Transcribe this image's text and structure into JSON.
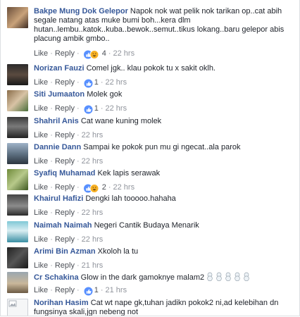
{
  "labels": {
    "like": "Like",
    "reply": "Reply"
  },
  "comments": [
    {
      "name": "Bakpe Mung Dok Gelepor",
      "text": "Napok nok wat pelik nok tarikan op..cat abih segale natang atas muke bumi boh...kera dlm hutan..lembu..katok..kuba..bewok..semut..tikus lokang..baru gelepor abis placung ambik gmbo..",
      "reactions": [
        "like",
        "haha"
      ],
      "count": "4",
      "time": "22 hrs"
    },
    {
      "name": "Norizan Fauzi",
      "text": "Comel jgk.. klau pokok tu x sakit oklh.",
      "reactions": [
        "like"
      ],
      "count": "1",
      "time": "22 hrs"
    },
    {
      "name": "Siti Jumaaton",
      "text": "Molek gok",
      "reactions": [
        "like"
      ],
      "count": "1",
      "time": "22 hrs"
    },
    {
      "name": "Shahril Anis",
      "text": "Cat wane kuning molek",
      "reactions": [],
      "count": "",
      "time": "22 hrs"
    },
    {
      "name": "Dannie Dann",
      "text": "Sampai ke pokok pun mu gi ngecat..ala parok",
      "reactions": [],
      "count": "",
      "time": "22 hrs"
    },
    {
      "name": "Syafiq Muhamad",
      "text": "Kek lapis serawak",
      "reactions": [
        "like",
        "haha"
      ],
      "count": "2",
      "time": "22 hrs"
    },
    {
      "name": "Khairul Hafizi",
      "text": "Dengki lah tooooo.hahaha",
      "reactions": [],
      "count": "",
      "time": "22 hrs"
    },
    {
      "name": "Naimah Naimah",
      "text": "Negeri Cantik Budaya Menarik",
      "reactions": [],
      "count": "",
      "time": "22 hrs"
    },
    {
      "name": "Arimi Bin Azman",
      "text": "Xkoloh la tu",
      "reactions": [],
      "count": "",
      "time": "21 hrs"
    },
    {
      "name": "Cr Schakina",
      "text": "Glow in the dark gamoknye malam2",
      "reactions": [
        "like"
      ],
      "count": "1",
      "time": "21 hrs"
    },
    {
      "name": "Norihan Hasim",
      "text": "Cat wt nape gk,tuhan jadikn pokok2 ni,ad kelebihan dn fungsinya skali,jgn nebeng not",
      "reactions": [],
      "count": "",
      "time": ""
    }
  ],
  "colors": {
    "name": "#365899",
    "text": "#1d2129",
    "meta": "#90949c",
    "like_blue": "#5890ff",
    "haha_yellow": "#f7b125"
  }
}
